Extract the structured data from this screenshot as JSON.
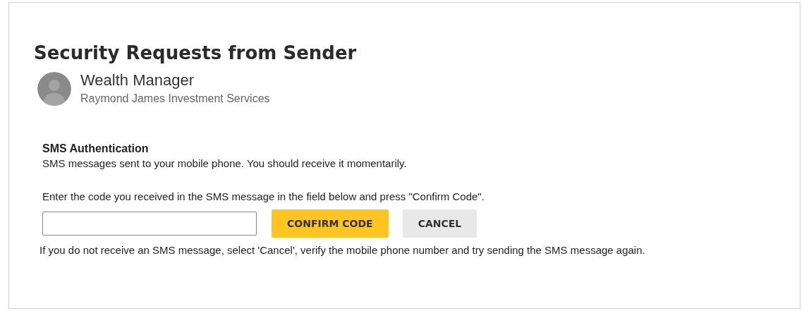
{
  "title": "Security Requests from Sender",
  "sender": {
    "name": "Wealth Manager",
    "organization": "Raymond James Investment Services"
  },
  "section": {
    "heading": "SMS Authentication",
    "message": "SMS messages sent to your mobile phone. You should receive it momentarily.",
    "instruction": "Enter the code you received in the SMS message in the field below and press \"Confirm Code\".",
    "buttons": [
      {
        "label": "CONFIRM CODE",
        "kind": "primary"
      },
      {
        "label": "CANCEL",
        "kind": "secondary"
      }
    ],
    "help": "If you do not receive an SMS message, select 'Cancel', verify the mobile phone number and try sending the SMS message again."
  }
}
